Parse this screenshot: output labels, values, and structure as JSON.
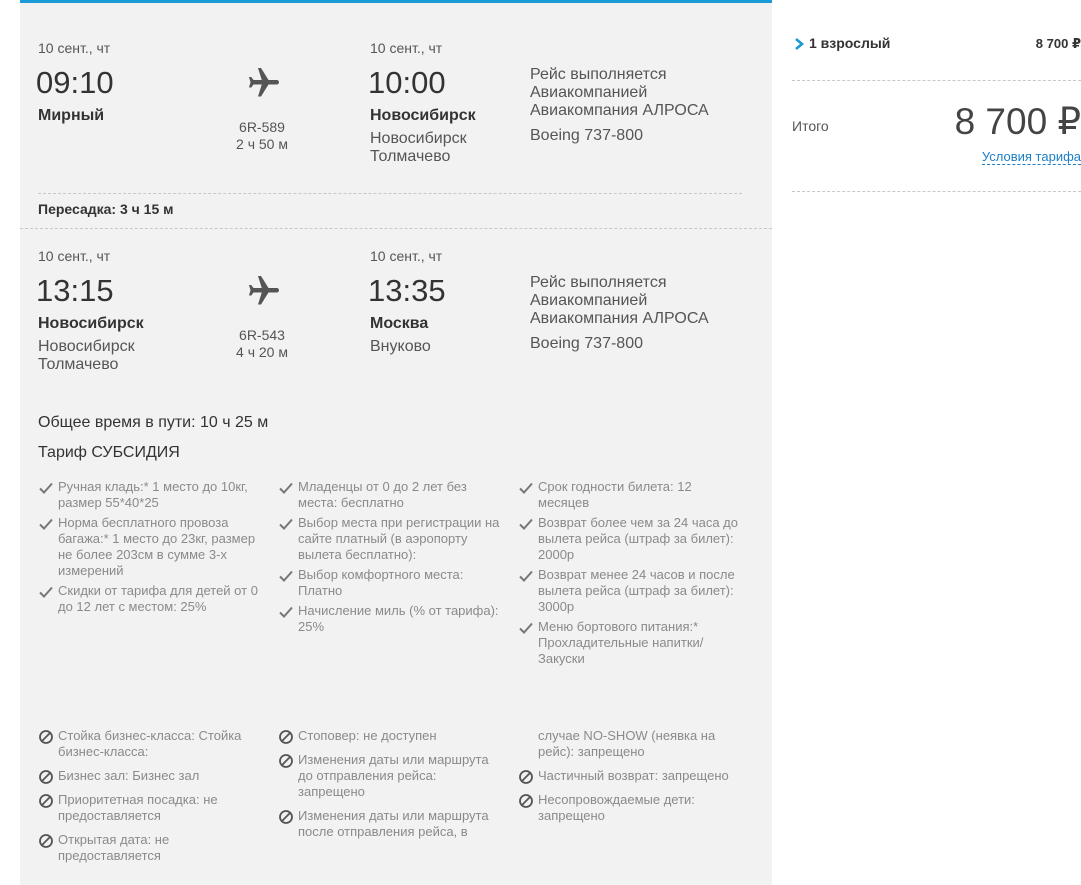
{
  "segments": [
    {
      "dep_date": "10 сент., чт",
      "dep_time": "09:10",
      "dep_city": "Мирный",
      "dep_airport": "",
      "flight_number": "6R-589",
      "duration": "2 ч 50 м",
      "arr_date": "10 сент., чт",
      "arr_time": "10:00",
      "arr_city": "Новосибирск",
      "arr_airport": "Новосибирск Толмачево",
      "operator": "Рейс выполняется Авиакомпанией Авиакомпания АЛРОСА",
      "aircraft": "Boeing 737-800"
    },
    {
      "dep_date": "10 сент., чт",
      "dep_time": "13:15",
      "dep_city": "Новосибирск",
      "dep_airport": "Новосибирск Толмачево",
      "flight_number": "6R-543",
      "duration": "4 ч 20 м",
      "arr_date": "10 сент., чт",
      "arr_time": "13:35",
      "arr_city": "Москва",
      "arr_airport": "Внуково",
      "operator": "Рейс выполняется Авиакомпанией Авиакомпания АЛРОСА",
      "aircraft": "Boeing 737-800"
    }
  ],
  "transfer": "Пересадка: 3 ч 15 м",
  "total_time": "Общее время в пути: 10 ч 25 м",
  "tariff": {
    "name": "Тариф СУБСИДИЯ",
    "included": [
      [
        "Ручная кладь:* 1 место до 10кг, размер 55*40*25",
        "Норма бесплатного провоза багажа:* 1 место до 23кг, размер не более 203см в сумме 3-х измерений",
        "Скидки от тарифа для детей от 0 до 12 лет с местом: 25%"
      ],
      [
        "Младенцы от 0 до 2 лет без места: бесплатно",
        "Выбор места при регистрации на сайте платный (в аэропорту вылета бесплатно):",
        "Выбор комфортного места: Платно",
        "Начисление миль (% от тарифа): 25%"
      ],
      [
        "Срок годности билета: 12 месяцев",
        "Возврат более чем за 24 часа до вылета рейса (штраф за билет): 2000р",
        "Возврат менее 24 часов и после вылета рейса (штраф за билет): 3000р",
        "Меню бортового питания:* Прохладительные напитки/Закуски"
      ]
    ],
    "excluded": [
      [
        "Стойка бизнес-класса: Стойка бизнес-класса:",
        "Бизнес зал: Бизнес зал",
        "Приоритетная посадка: не предоставляется",
        "Открытая дата: не предоставляется"
      ],
      [
        "Стоповер: не доступен",
        "Изменения даты или маршрута до отправления рейса: запрещено",
        "Изменения даты или маршрута после отправления рейса, в"
      ],
      [
        "случае NO-SHOW (неявка на рейс): запрещено",
        "Частичный возврат: запрещено",
        "Несопровождаемые дети: запрещено"
      ]
    ]
  },
  "summary": {
    "pax_label": "1 взрослый",
    "pax_price": "8 700 ₽",
    "total_label": "Итого",
    "total_price": "8 700 ₽",
    "tariff_link": "Условия тарифа"
  },
  "icons": {
    "plane": "airplane-icon",
    "included": "check-icon",
    "excluded": "forbidden-icon",
    "pax_toggle": "chevron-right-icon"
  },
  "colors": {
    "accent": "#1a9ad6",
    "link": "#1a7fc4",
    "card_bg": "#f2f2f2",
    "muted": "#8a8a8a"
  }
}
